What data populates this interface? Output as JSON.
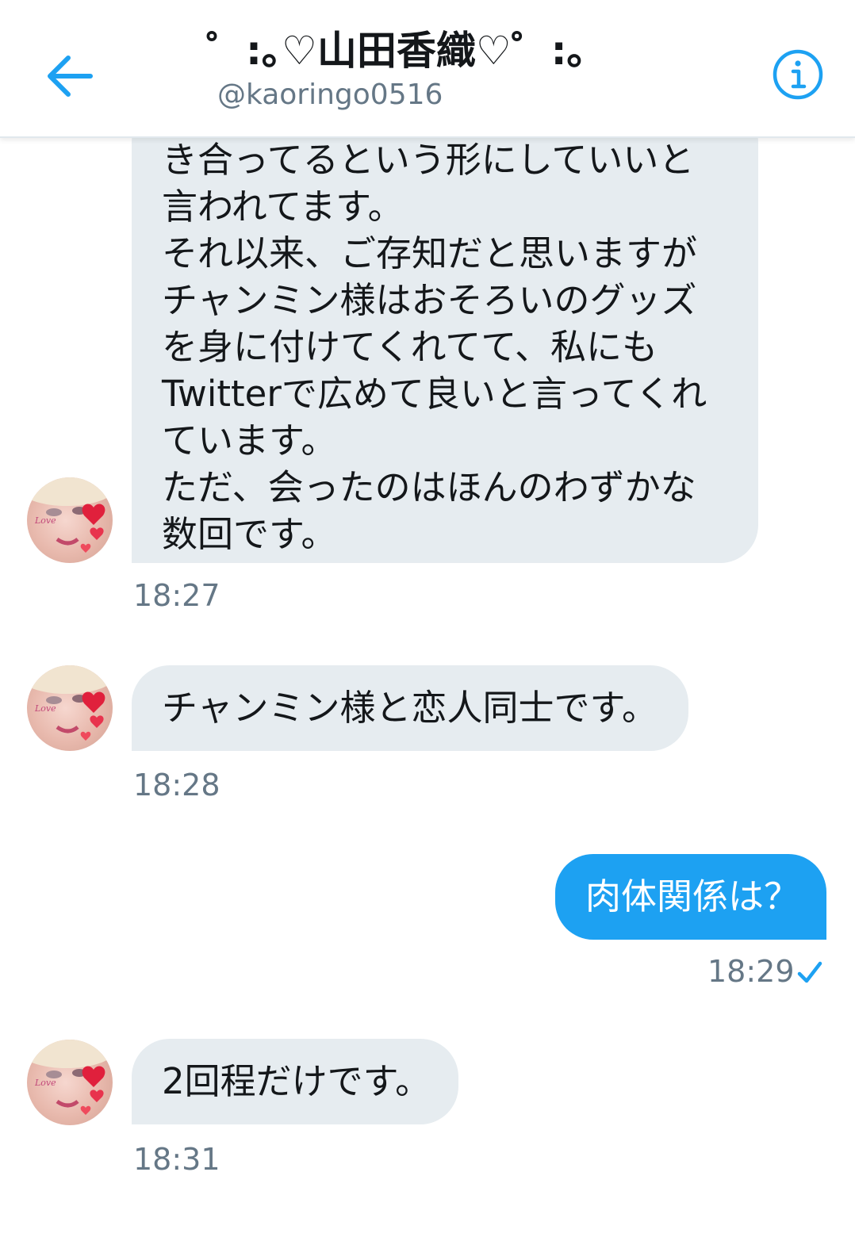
{
  "header": {
    "title": "゜:｡♡山田香織♡゜:｡",
    "handle": "@kaoringo0516",
    "back_icon": "arrow-left-icon",
    "info_icon": "info-icon",
    "accent_color": "#1da1f2"
  },
  "messages": [
    {
      "direction": "incoming",
      "lines": [
        "き合ってるという形にしていいと",
        "言われてます。",
        "それ以来、ご存知だと思いますが",
        "チャンミン様はおそろいのグッズ",
        "を身に付けてくれてて、私にも",
        "Twitterで広めて良いと言ってくれ",
        "ています。",
        "ただ、会ったのはほんのわずかな",
        "数回です。"
      ],
      "time": "18:27"
    },
    {
      "direction": "incoming",
      "lines": [
        "チャンミン様と恋人同士です。"
      ],
      "time": "18:28"
    },
    {
      "direction": "outgoing",
      "lines": [
        "肉体関係は？"
      ],
      "time": "18:29",
      "status_icon": "checkmark-icon"
    },
    {
      "direction": "incoming",
      "lines": [
        "2回程だけです。"
      ],
      "time": "18:31"
    }
  ],
  "colors": {
    "incoming_bubble": "#e6ecf0",
    "outgoing_bubble": "#1da1f2",
    "timestamp": "#657786"
  }
}
